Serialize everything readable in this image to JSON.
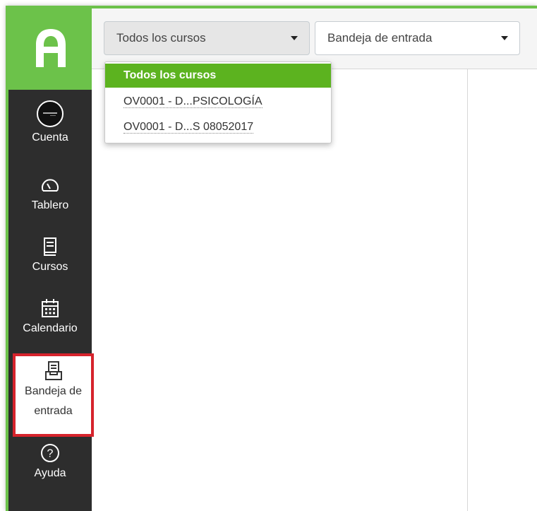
{
  "brand": {
    "accent": "#6cc24a",
    "sidebar_bg": "#2d2d2d",
    "highlight_border": "#d6232c"
  },
  "sidebar": {
    "items": [
      {
        "label": "Cuenta",
        "icon": "avatar"
      },
      {
        "label": "Tablero",
        "icon": "dashboard-gauge-icon"
      },
      {
        "label": "Cursos",
        "icon": "book-icon"
      },
      {
        "label": "Calendario",
        "icon": "calendar-icon"
      },
      {
        "label_line1": "Bandeja de",
        "label_line2": "entrada",
        "icon": "inbox-icon"
      },
      {
        "label": "Ayuda",
        "icon": "help-icon"
      }
    ]
  },
  "toolbar": {
    "course_filter": "Todos los cursos",
    "mailbox_filter": "Bandeja de entrada"
  },
  "course_dropdown": {
    "options": [
      "Todos los cursos",
      "OV0001 - D...PSICOLOGÍA",
      "OV0001 - D...S 08052017"
    ],
    "selected_index": 0
  }
}
